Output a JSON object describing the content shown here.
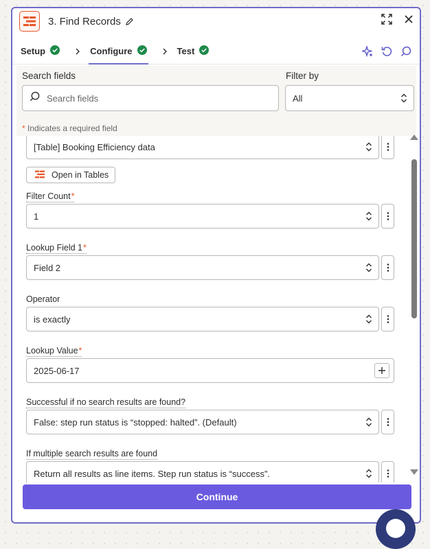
{
  "header": {
    "step_title": "3. Find Records"
  },
  "tabs": [
    {
      "label": "Setup",
      "complete": true
    },
    {
      "label": "Configure",
      "complete": true,
      "active": true
    },
    {
      "label": "Test",
      "complete": true
    }
  ],
  "search": {
    "label": "Search fields",
    "placeholder": "Search fields",
    "filter_label": "Filter by",
    "filter_value": "All",
    "required_star": "*",
    "required_note": "Indicates a required field"
  },
  "fields": {
    "table_value": "[Table] Booking Efficiency data",
    "open_tables_label": "Open in Tables",
    "filter_count": {
      "label": "Filter Count",
      "required": "*",
      "value": "1"
    },
    "lookup_field": {
      "label": "Lookup Field 1",
      "required": "*",
      "value": "Field 2"
    },
    "operator": {
      "label": "Operator",
      "value": "is exactly"
    },
    "lookup_value": {
      "label": "Lookup Value",
      "required": "*",
      "value": "2025-06-17"
    },
    "success_no_results": {
      "label": "Successful if no search results are found?",
      "value": "False: step run status is “stopped: halted”. (Default)"
    },
    "multiple_results": {
      "label": "If multiple search results are found",
      "value": "Return all results as line items. Step run status is “success”."
    }
  },
  "footer": {
    "continue_label": "Continue"
  },
  "colors": {
    "accent": "#6a5ae0",
    "panel_border": "#6e6bc8",
    "brand_orange": "#e8572a",
    "success_green": "#1d8a4a"
  },
  "icons": [
    "tables-logo-icon",
    "pencil-icon",
    "expand-icon",
    "close-icon",
    "check-circle-icon",
    "chevron-right-icon",
    "sparkle-icon",
    "refresh-icon",
    "search-icon",
    "updown-chevron-icon",
    "kebab-icon",
    "plus-icon"
  ]
}
